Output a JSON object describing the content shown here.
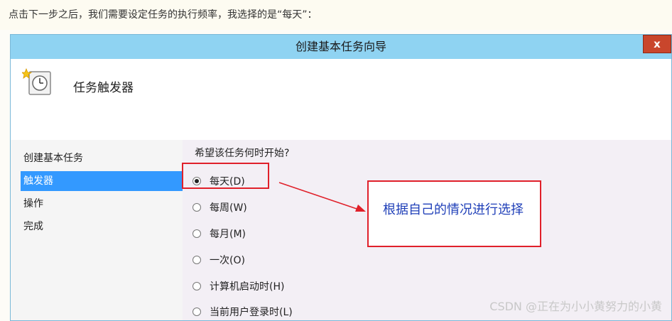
{
  "caption": "点击下一步之后，我们需要设定任务的执行频率，我选择的是“每天”：",
  "dialog": {
    "title": "创建基本任务向导",
    "close_label": "x",
    "header_title": "任务触发器",
    "nav": [
      {
        "label": "创建基本任务",
        "selected": false
      },
      {
        "label": "触发器",
        "selected": true
      },
      {
        "label": "操作",
        "selected": false
      },
      {
        "label": "完成",
        "selected": false
      }
    ],
    "question": "希望该任务何时开始?",
    "options": [
      {
        "label": "每天(D)",
        "checked": true
      },
      {
        "label": "每周(W)",
        "checked": false
      },
      {
        "label": "每月(M)",
        "checked": false
      },
      {
        "label": "一次(O)",
        "checked": false
      },
      {
        "label": "计算机启动时(H)",
        "checked": false
      },
      {
        "label": "当前用户登录时(L)",
        "checked": false
      }
    ]
  },
  "annotation": {
    "callout_text": "根据自己的情况进行选择",
    "color": "#e0202a",
    "text_color": "#1f3fb8"
  },
  "watermark": "CSDN @正在为小小黄努力的小黄",
  "colors": {
    "titlebar": "#8fd3f2",
    "selection": "#3399ff",
    "close": "#c9462c"
  }
}
